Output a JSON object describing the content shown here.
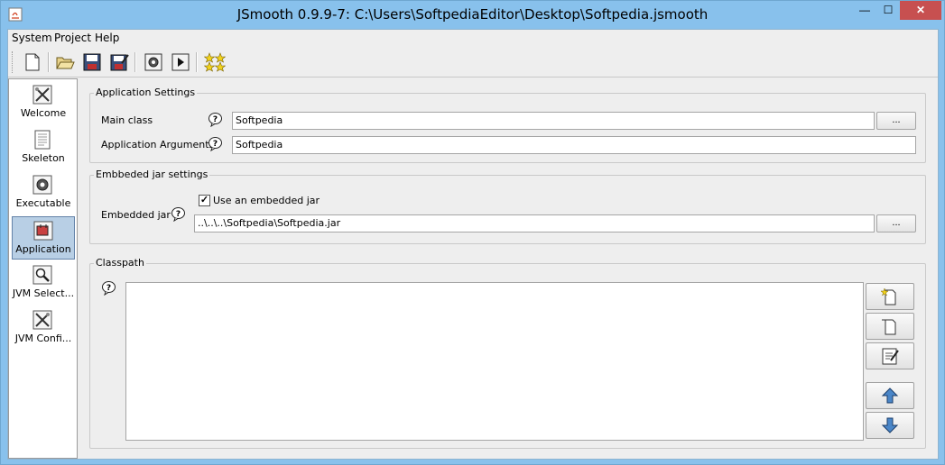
{
  "window": {
    "title": "JSmooth 0.9.9-7: C:\\Users\\SoftpediaEditor\\Desktop\\Softpedia.jsmooth",
    "minimize_glyph": "—",
    "maximize_glyph": "☐",
    "close_glyph": "✕"
  },
  "menu": {
    "system": "System",
    "project": "Project",
    "help": "Help"
  },
  "toolbar": {
    "icons": [
      "new-file-icon",
      "open-folder-icon",
      "save-icon",
      "save-as-icon",
      "compile-icon",
      "run-icon",
      "about-stars-icon"
    ]
  },
  "nav": {
    "items": [
      {
        "label": "Welcome",
        "icon": "welcome-tools-icon"
      },
      {
        "label": "Skeleton",
        "icon": "skeleton-page-icon"
      },
      {
        "label": "Executable",
        "icon": "executable-gear-icon"
      },
      {
        "label": "Application",
        "icon": "application-icon"
      },
      {
        "label": "JVM Select...",
        "icon": "jvm-select-magnifier-icon"
      },
      {
        "label": "JVM Confi...",
        "icon": "jvm-config-tools-icon"
      }
    ],
    "selected": "Application"
  },
  "app_settings": {
    "title": "Application Settings",
    "main_class_label": "Main class",
    "main_class_value": "Softpedia",
    "browse_label": "...",
    "args_label": "Application Arguments",
    "args_value": "Softpedia"
  },
  "embedded_jar": {
    "title": "Embbeded jar settings",
    "label": "Embedded jar",
    "checkbox_label": "Use an embedded jar",
    "checkbox_checked": true,
    "checkbox_glyph": "✓",
    "jar_path": "..\\..\\..\\Softpedia\\Softpedia.jar",
    "browse_label": "..."
  },
  "classpath": {
    "title": "Classpath",
    "buttons": [
      "add-file-icon",
      "add-folder-icon",
      "edit-icon",
      "move-up-icon",
      "move-down-icon"
    ]
  }
}
